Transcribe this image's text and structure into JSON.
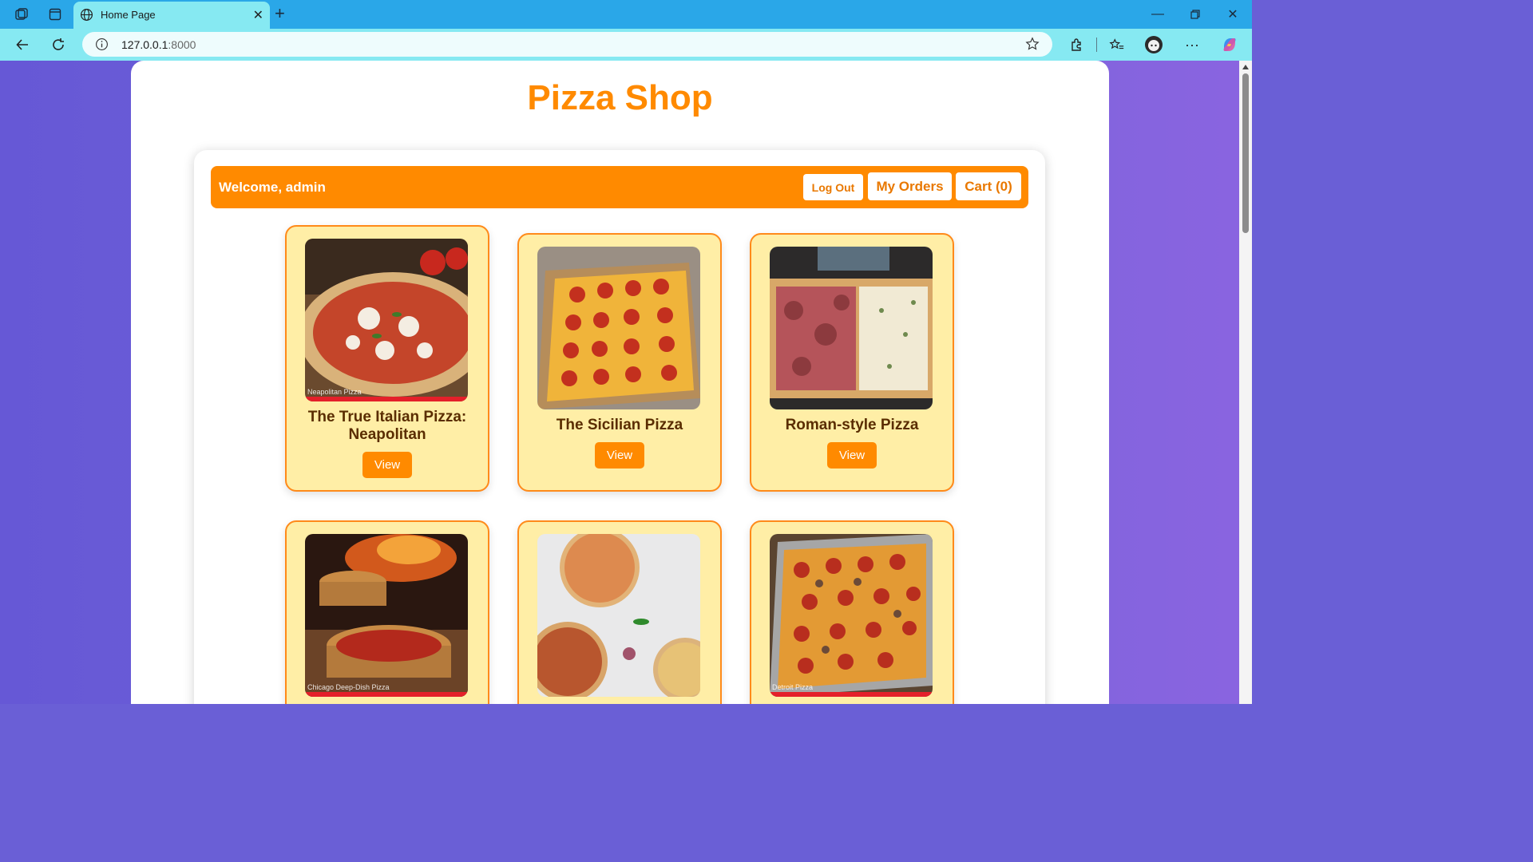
{
  "browser": {
    "tab_title": "Home Page",
    "url_host": "127.0.0.1",
    "url_port": ":8000"
  },
  "page": {
    "site_title": "Pizza Shop",
    "welcome": "Welcome, admin",
    "buttons": {
      "logout": "Log Out",
      "orders": "My Orders",
      "cart": "Cart (0)"
    }
  },
  "products": [
    {
      "name": "The True Italian Pizza: Neapolitan",
      "view": "View",
      "caption": "Neapolitan Pizza"
    },
    {
      "name": "The Sicilian Pizza",
      "view": "View",
      "caption": ""
    },
    {
      "name": "Roman-style Pizza",
      "view": "View",
      "caption": ""
    },
    {
      "name": "",
      "view": "",
      "caption": "Chicago Deep-Dish Pizza"
    },
    {
      "name": "",
      "view": "",
      "caption": ""
    },
    {
      "name": "",
      "view": "",
      "caption": "Detroit Pizza"
    }
  ],
  "colors": {
    "accent": "#ff8a00",
    "card_bg": "#ffeea6",
    "browser_title": "#2aa7e8",
    "browser_toolbar": "#86e9f2"
  },
  "icons": [
    "workspaces-icon",
    "tab-actions-icon",
    "globe-icon",
    "close-icon",
    "plus-icon",
    "minimize-icon",
    "restore-icon",
    "back-icon",
    "refresh-icon",
    "info-icon",
    "star-icon",
    "extensions-icon",
    "favorites-icon",
    "profile-icon",
    "more-icon",
    "copilot-icon"
  ]
}
